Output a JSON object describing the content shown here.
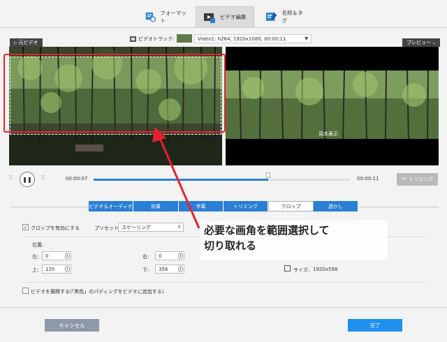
{
  "tabs": [
    {
      "label": "フォーマット",
      "icon": "format-icon"
    },
    {
      "label": "ビデオ編集",
      "icon": "video-edit-icon"
    },
    {
      "label": "名称＆タグ",
      "icon": "name-tag-icon"
    }
  ],
  "track": {
    "label": "ビデオトラック:",
    "value": "Video1: h264, 1920x1080, 00:00:11"
  },
  "panels": {
    "original": "元ビデオ",
    "preview": "プレビュー"
  },
  "watermark": "見本表示",
  "player": {
    "current": "00:00:07",
    "total": "00:00:11",
    "progress": 0.68,
    "trim_label": "トリミング"
  },
  "subtabs": [
    "ビデオ＆オーディオ",
    "効果",
    "字幕",
    "トリミング",
    "クロップ",
    "透かし"
  ],
  "crop": {
    "enable_label": "クロップを有効にする",
    "preset_label": "プリセット:",
    "preset_value": "スケーリング",
    "position_label": "位置:",
    "left_label": "左:",
    "left_value": "0",
    "right_label": "右:",
    "right_value": "0",
    "top_label": "上:",
    "top_value": "125",
    "bottom_label": "下:",
    "bottom_value": "356",
    "size_label": "サイズ:",
    "size_value": "1920x598",
    "expand_label": "ビデオを展開する(「黒色」のパディングをビデオに追加する)"
  },
  "annotation": {
    "line1": "必要な画角を範囲選択して",
    "line2": "切り取れる",
    "color": "#e8212b"
  },
  "footer": {
    "cancel": "キャンセル",
    "done": "完了"
  },
  "colors": {
    "accent": "#2a7fd4",
    "cancel_bg": "#8d99a8",
    "done_bg": "#1f8ff0"
  }
}
